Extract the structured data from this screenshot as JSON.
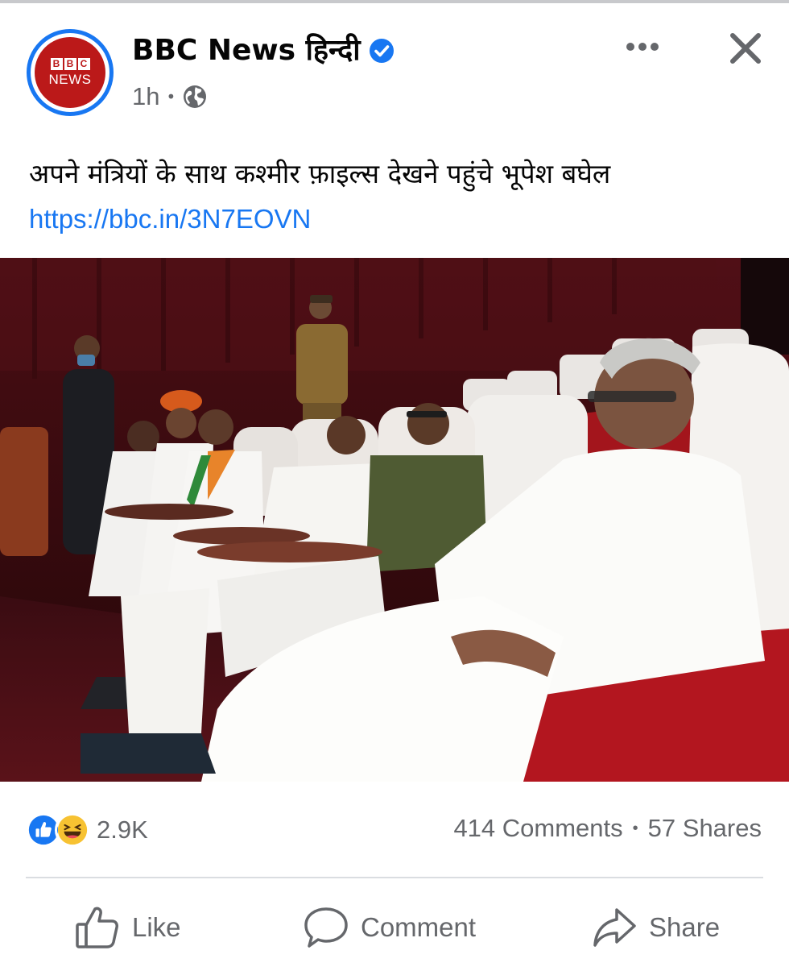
{
  "post": {
    "page_name": "BBC News हिन्दी",
    "avatar_logo": {
      "blocks": [
        "B",
        "B",
        "C"
      ],
      "word": "NEWS"
    },
    "time": "1h",
    "separator": "•",
    "audience_icon": "globe-icon",
    "verified_icon": "verified-badge-icon",
    "caption_text": "अपने मंत्रियों के साथ कश्मीर फ़ाइल्स देखने पहुंचे भूपेश बघेल",
    "caption_link": "https://bbc.in/3N7EOVN"
  },
  "header_actions": {
    "more_icon": "more-options-icon",
    "close_icon": "close-icon"
  },
  "photo": {
    "subject": "photo"
  },
  "stats": {
    "reaction_icons": [
      "like-reaction-icon",
      "haha-reaction-icon"
    ],
    "reaction_count": "2.9K",
    "comments": "414 Comments",
    "separator": "•",
    "shares": "57 Shares"
  },
  "actions": {
    "like_label": "Like",
    "comment_label": "Comment",
    "share_label": "Share"
  },
  "colors": {
    "accent": "#1877f2",
    "bbc_red": "#bb1919",
    "text_secondary": "#65676b"
  }
}
